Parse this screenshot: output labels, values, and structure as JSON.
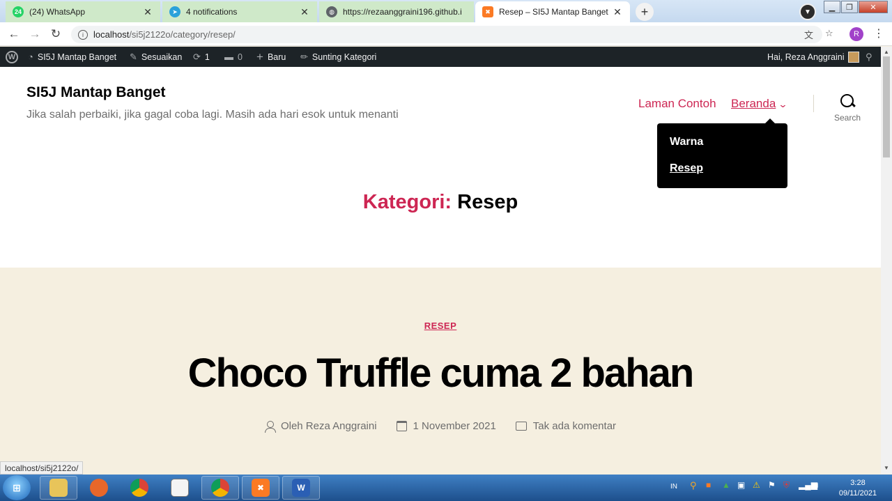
{
  "browser": {
    "tabs": [
      {
        "badge": "24",
        "title": "(24) WhatsApp",
        "favicon": "whatsapp-icon",
        "color": "#25d366"
      },
      {
        "title": "4 notifications",
        "favicon": "telegram-icon",
        "color": "#2aa1da"
      },
      {
        "title": "https://rezaanggraini196.github.i",
        "favicon": "globe-icon",
        "color": "#5f6368"
      },
      {
        "title": "Resep – SI5J Mantap Banget",
        "favicon": "xampp-icon",
        "color": "#fb7a24"
      }
    ],
    "new_tab": "+",
    "url_host": "localhost",
    "url_path": "/si5j2122o/category/resep/",
    "profile_initial": "R",
    "status_url": "localhost/si5j2122o/"
  },
  "admin_bar": {
    "site_name": "SI5J Mantap Banget",
    "customize": "Sesuaikan",
    "updates": "1",
    "comments": "0",
    "new": "Baru",
    "edit": "Sunting Kategori",
    "greeting": "Hai, Reza Anggraini"
  },
  "site": {
    "title": "SI5J Mantap Banget",
    "description": "Jika salah perbaiki, jika gagal coba lagi. Masih ada hari esok untuk menanti"
  },
  "menu": {
    "items": [
      {
        "label": "Laman Contoh"
      },
      {
        "label": "Beranda"
      }
    ],
    "submenu": [
      {
        "label": "Warna"
      },
      {
        "label": "Resep"
      }
    ],
    "search_label": "Search"
  },
  "archive": {
    "prefix": "Kategori:",
    "name": "Resep"
  },
  "post": {
    "category": "RESEP",
    "title": "Choco Truffle cuma 2 bahan",
    "author": "Oleh Reza Anggraini",
    "date": "1 November 2021",
    "comments": "Tak ada komentar"
  },
  "taskbar": {
    "language": "IN",
    "time": "3:28",
    "date": "09/11/2021"
  },
  "colors": {
    "accent": "#cd2653",
    "post_bg": "#f5efe0",
    "admin_bar": "#1d2327"
  }
}
